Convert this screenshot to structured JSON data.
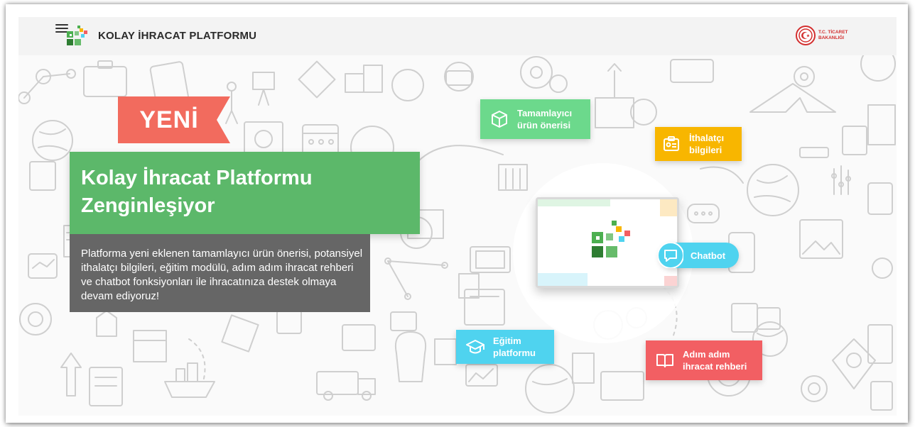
{
  "header": {
    "brand": "KOLAY İHRACAT PLATFORMU",
    "ministry_line1": "T.C. TİCARET",
    "ministry_line2": "BAKANLIĞI"
  },
  "banner": {
    "badge": "YENİ",
    "headline_line1": "Kolay İhracat Platformu",
    "headline_line2": "Zenginleşiyor",
    "description": "Platforma yeni eklenen tamamlayıcı ürün önerisi, potansiyel ithalatçı bilgileri, eğitim modülü, adım adım ihracat rehberi ve chatbot fonksiyonları ile ihracatınıza destek olmaya devam ediyoruz!"
  },
  "features": {
    "complementary": {
      "line1": "Tamamlayıcı",
      "line2": "ürün önerisi",
      "icon": "box-icon"
    },
    "importer": {
      "line1": "İthalatçı",
      "line2": "bilgileri",
      "icon": "id-card-icon"
    },
    "chatbot": {
      "label": "Chatbot",
      "icon": "chat-bubble-icon"
    },
    "education": {
      "line1": "Eğitim",
      "line2": "platformu",
      "icon": "graduation-cap-icon"
    },
    "guide": {
      "line1": "Adım adım",
      "line2": "ihracat rehberi",
      "icon": "open-book-icon"
    }
  },
  "colors": {
    "badge": "#f26b5e",
    "headline": "#5cb86a",
    "description_bg": "#666666",
    "green": "#6cd98c",
    "orange": "#f8b600",
    "cyan": "#4fd3ef",
    "red": "#f25f63"
  }
}
